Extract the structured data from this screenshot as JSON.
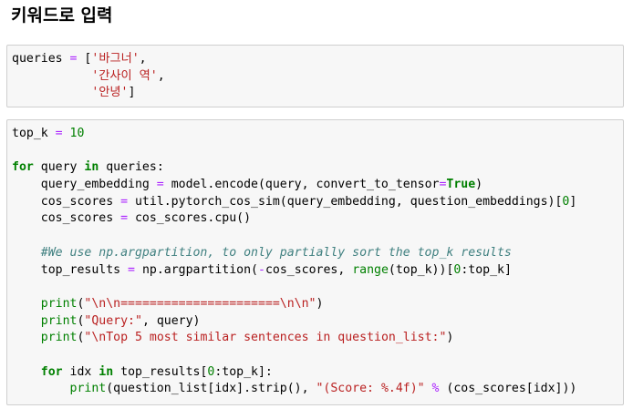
{
  "page": {
    "heading": "키워드로 입력"
  },
  "cells": [
    {
      "lines": [
        [
          [
            "queries ",
            "t"
          ],
          [
            "=",
            "o"
          ],
          [
            " [",
            "t"
          ],
          [
            "'바그너'",
            "s"
          ],
          [
            ",",
            "t"
          ]
        ],
        [
          [
            "           ",
            "t"
          ],
          [
            "'간사이 역'",
            "s"
          ],
          [
            ",",
            "t"
          ]
        ],
        [
          [
            "           ",
            "t"
          ],
          [
            "'안녕'",
            "s"
          ],
          [
            "]",
            "t"
          ]
        ]
      ]
    },
    {
      "lines": [
        [
          [
            "top_k ",
            "t"
          ],
          [
            "=",
            "o"
          ],
          [
            " ",
            "t"
          ],
          [
            "10",
            "n"
          ]
        ],
        [],
        [
          [
            "for",
            "k"
          ],
          [
            " query ",
            "t"
          ],
          [
            "in",
            "k"
          ],
          [
            " queries:",
            "t"
          ]
        ],
        [
          [
            "    query_embedding ",
            "t"
          ],
          [
            "=",
            "o"
          ],
          [
            " model.encode(query, convert_to_tensor",
            "t"
          ],
          [
            "=",
            "o"
          ],
          [
            "True",
            "k"
          ],
          [
            ")",
            "t"
          ]
        ],
        [
          [
            "    cos_scores ",
            "t"
          ],
          [
            "=",
            "o"
          ],
          [
            " util.pytorch_cos_sim(query_embedding, question_embeddings)[",
            "t"
          ],
          [
            "0",
            "n"
          ],
          [
            "]",
            "t"
          ]
        ],
        [
          [
            "    cos_scores ",
            "t"
          ],
          [
            "=",
            "o"
          ],
          [
            " cos_scores.cpu()",
            "t"
          ]
        ],
        [],
        [
          [
            "    ",
            "t"
          ],
          [
            "#We use np.argpartition, to only partially sort the top_k results",
            "c"
          ]
        ],
        [
          [
            "    top_results ",
            "t"
          ],
          [
            "=",
            "o"
          ],
          [
            " np.argpartition(",
            "t"
          ],
          [
            "-",
            "o"
          ],
          [
            "cos_scores, ",
            "t"
          ],
          [
            "range",
            "b"
          ],
          [
            "(top_k))[",
            "t"
          ],
          [
            "0",
            "n"
          ],
          [
            ":top_k]",
            "t"
          ]
        ],
        [],
        [
          [
            "    ",
            "t"
          ],
          [
            "print",
            "b"
          ],
          [
            "(",
            "t"
          ],
          [
            "\"\\n\\n======================\\n\\n\"",
            "s"
          ],
          [
            ")",
            "t"
          ]
        ],
        [
          [
            "    ",
            "t"
          ],
          [
            "print",
            "b"
          ],
          [
            "(",
            "t"
          ],
          [
            "\"Query:\"",
            "s"
          ],
          [
            ", query)",
            "t"
          ]
        ],
        [
          [
            "    ",
            "t"
          ],
          [
            "print",
            "b"
          ],
          [
            "(",
            "t"
          ],
          [
            "\"\\nTop 5 most similar sentences in question_list:\"",
            "s"
          ],
          [
            ")",
            "t"
          ]
        ],
        [],
        [
          [
            "    ",
            "t"
          ],
          [
            "for",
            "k"
          ],
          [
            " idx ",
            "t"
          ],
          [
            "in",
            "k"
          ],
          [
            " top_results[",
            "t"
          ],
          [
            "0",
            "n"
          ],
          [
            ":top_k]:",
            "t"
          ]
        ],
        [
          [
            "        ",
            "t"
          ],
          [
            "print",
            "b"
          ],
          [
            "(question_list[idx].strip(), ",
            "t"
          ],
          [
            "\"(Score: %.4f)\"",
            "s"
          ],
          [
            " ",
            "t"
          ],
          [
            "%",
            "o"
          ],
          [
            " (cos_scores[idx]))",
            "t"
          ]
        ]
      ]
    }
  ]
}
